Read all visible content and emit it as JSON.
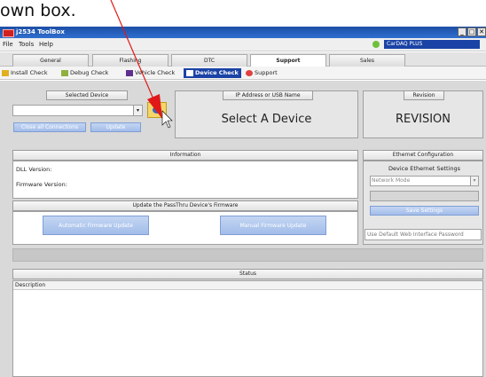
{
  "caption": "own box.",
  "window": {
    "title": "j2534 ToolBox"
  },
  "menu": {
    "file": "File",
    "tools": "Tools",
    "help": "Help"
  },
  "device_selector": {
    "value": "CarDAQ PLUS"
  },
  "tabs": [
    {
      "label": "General"
    },
    {
      "label": "Flashing"
    },
    {
      "label": "DTC"
    },
    {
      "label": "Support"
    },
    {
      "label": "Sales"
    }
  ],
  "subtabs": [
    {
      "label": "Install Check"
    },
    {
      "label": "Debug Check"
    },
    {
      "label": "Vehicle Check"
    },
    {
      "label": "Device Check"
    },
    {
      "label": "Support"
    }
  ],
  "selected_device": {
    "header": "Selected Device",
    "dropdown_value": "",
    "close_all": "Close all Connections",
    "update": "Update"
  },
  "ip_panel": {
    "header": "IP Address or USB Name",
    "value": "Select A Device"
  },
  "revision_panel": {
    "header": "Revision",
    "value": "REVISION"
  },
  "information": {
    "header": "Information",
    "dll_label": "DLL Version:",
    "firmware_label": "Firmware Version:"
  },
  "firmware_update": {
    "header": "Update the PassThru Device's Firmware",
    "auto": "Automatic Firmware Update",
    "manual": "Manual Firmware Update"
  },
  "ethernet": {
    "header": "Ethernet Configuration",
    "group": "Device Ethernet Settings",
    "network_mode": "Network Mode",
    "save": "Save Settings",
    "password_placeholder": "Use Default Web Interface Password"
  },
  "status": {
    "header": "Status",
    "column": "Description"
  },
  "colors": {
    "title_blue": "#1b43a6",
    "button_blue": "#a3bde9",
    "arrow_red": "#e01818"
  }
}
